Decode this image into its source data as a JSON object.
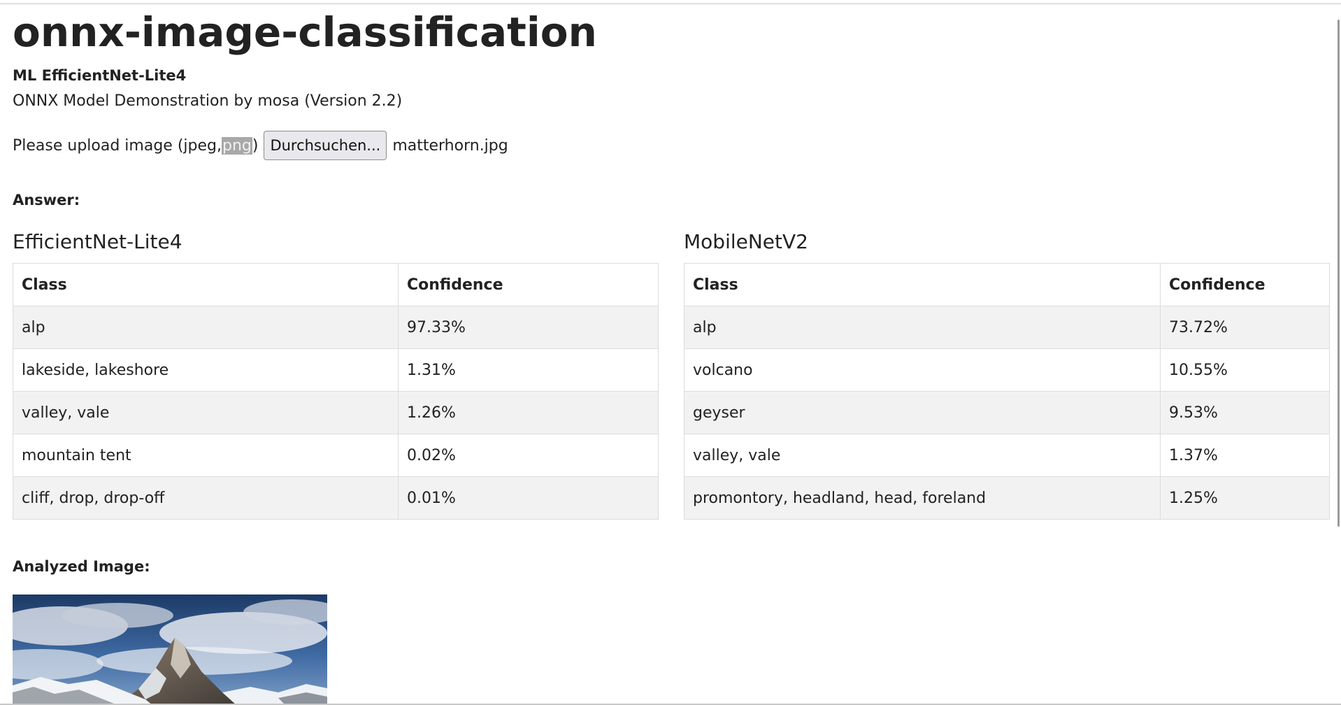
{
  "page": {
    "title": "onnx-image-classification",
    "subtitle": "ML EfficientNet-Lite4",
    "demo_line": "ONNX Model Demonstration by mosa (Version 2.2)"
  },
  "upload": {
    "prompt_start": "Please upload image (jpeg,",
    "prompt_highlight": "png",
    "prompt_end": ")",
    "browse_label": "Durchsuchen...",
    "file_name": "matterhorn.jpg"
  },
  "answer_label": "Answer:",
  "models": [
    {
      "name": "EfficientNet-Lite4",
      "headers": [
        "Class",
        "Confidence"
      ],
      "rows": [
        [
          "alp",
          "97.33%"
        ],
        [
          "lakeside, lakeshore",
          "1.31%"
        ],
        [
          "valley, vale",
          "1.26%"
        ],
        [
          "mountain tent",
          "0.02%"
        ],
        [
          "cliff, drop, drop-off",
          "0.01%"
        ]
      ]
    },
    {
      "name": "MobileNetV2",
      "headers": [
        "Class",
        "Confidence"
      ],
      "rows": [
        [
          "alp",
          "73.72%"
        ],
        [
          "volcano",
          "10.55%"
        ],
        [
          "geyser",
          "9.53%"
        ],
        [
          "valley, vale",
          "1.37%"
        ],
        [
          "promontory, headland, head, foreland",
          "1.25%"
        ]
      ]
    }
  ],
  "analyzed_label": "Analyzed Image:",
  "colors": {
    "text": "#222222",
    "table_stripe": "#f2f2f2",
    "table_border": "#dcdcdc",
    "button_bg": "#e9e9ed",
    "highlight_bg": "#a8a8a8"
  }
}
